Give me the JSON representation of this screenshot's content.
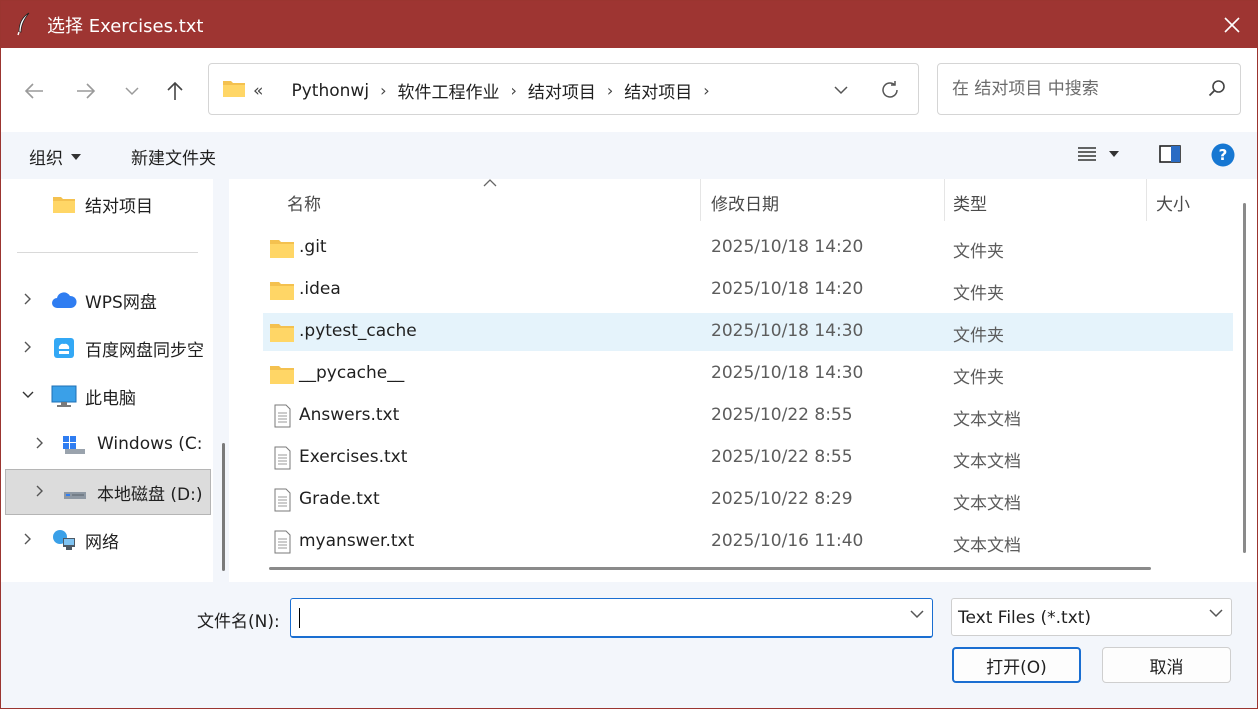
{
  "window": {
    "title": "选择 Exercises.txt",
    "accent_color": "#9e3532"
  },
  "nav": {
    "back_icon": "arrow-left-icon",
    "forward_icon": "arrow-right-icon",
    "recent_icon": "chevron-down-icon",
    "up_icon": "arrow-up-icon"
  },
  "address": {
    "overflow": "«",
    "crumbs": [
      "Pythonwj",
      "软件工程作业",
      "结对项目",
      "结对项目"
    ]
  },
  "search": {
    "placeholder": "在 结对项目 中搜索"
  },
  "toolbar": {
    "organize": "组织",
    "new_folder": "新建文件夹"
  },
  "sidebar": {
    "items": [
      {
        "label": "结对项目",
        "icon": "folder-icon"
      },
      {
        "label": "WPS网盘",
        "icon": "cloud-icon"
      },
      {
        "label": "百度网盘同步空",
        "icon": "baidu-netdisk-icon"
      },
      {
        "label": "此电脑",
        "icon": "computer-icon"
      },
      {
        "label": "Windows  (C:",
        "icon": "windows-drive-icon"
      },
      {
        "label": "本地磁盘 (D:)",
        "icon": "hard-drive-icon"
      },
      {
        "label": "网络",
        "icon": "network-icon"
      }
    ]
  },
  "columns": {
    "name": "名称",
    "date": "修改日期",
    "type": "类型",
    "size": "大小"
  },
  "files": [
    {
      "name": ".git",
      "date": "2025/10/18 14:20",
      "type": "文件夹",
      "kind": "folder"
    },
    {
      "name": ".idea",
      "date": "2025/10/18 14:20",
      "type": "文件夹",
      "kind": "folder"
    },
    {
      "name": ".pytest_cache",
      "date": "2025/10/18 14:30",
      "type": "文件夹",
      "kind": "folder"
    },
    {
      "name": "__pycache__",
      "date": "2025/10/18 14:30",
      "type": "文件夹",
      "kind": "folder"
    },
    {
      "name": "Answers.txt",
      "date": "2025/10/22 8:55",
      "type": "文本文档",
      "kind": "text"
    },
    {
      "name": "Exercises.txt",
      "date": "2025/10/22 8:55",
      "type": "文本文档",
      "kind": "text"
    },
    {
      "name": "Grade.txt",
      "date": "2025/10/22 8:29",
      "type": "文本文档",
      "kind": "text"
    },
    {
      "name": "myanswer.txt",
      "date": "2025/10/16 11:40",
      "type": "文本文档",
      "kind": "text"
    }
  ],
  "bottom": {
    "filename_label": "文件名(N):",
    "filename_value": "",
    "filter_value": "Text Files (*.txt)",
    "open_button": "打开(O)",
    "cancel_button": "取消"
  }
}
